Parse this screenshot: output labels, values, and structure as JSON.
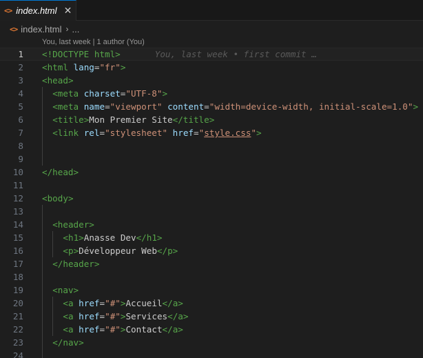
{
  "tab": {
    "icon": "html-file-icon",
    "label": "index.html",
    "close_glyph": "✕"
  },
  "breadcrumb": {
    "file": "index.html",
    "separator": "›",
    "ellipsis": "..."
  },
  "codelens": "You, last week | 1 author (You)",
  "blame": "You, last week • first commit …",
  "colors": {
    "tag": "#57a64a",
    "attribute": "#9cdcfe",
    "string": "#ce9178",
    "text": "#cccccc",
    "line_number": "#6e7681"
  },
  "lines": [
    {
      "n": "1",
      "indent": 0,
      "tokens": [
        [
          "doctype",
          "<!DOCTYPE html>"
        ]
      ],
      "blame": true,
      "current": true
    },
    {
      "n": "2",
      "indent": 0,
      "tokens": [
        [
          "bracket",
          "<"
        ],
        [
          "tag",
          "html"
        ],
        [
          "text",
          " "
        ],
        [
          "attr",
          "lang"
        ],
        [
          "text",
          "="
        ],
        [
          "str",
          "\"fr\""
        ],
        [
          "bracket",
          ">"
        ]
      ]
    },
    {
      "n": "3",
      "indent": 0,
      "tokens": [
        [
          "bracket",
          "<"
        ],
        [
          "tag",
          "head"
        ],
        [
          "bracket",
          ">"
        ]
      ]
    },
    {
      "n": "4",
      "indent": 1,
      "tokens": [
        [
          "bracket",
          "<"
        ],
        [
          "tag",
          "meta"
        ],
        [
          "text",
          " "
        ],
        [
          "attr",
          "charset"
        ],
        [
          "text",
          "="
        ],
        [
          "str",
          "\"UTF-8\""
        ],
        [
          "bracket",
          ">"
        ]
      ]
    },
    {
      "n": "5",
      "indent": 1,
      "tokens": [
        [
          "bracket",
          "<"
        ],
        [
          "tag",
          "meta"
        ],
        [
          "text",
          " "
        ],
        [
          "attr",
          "name"
        ],
        [
          "text",
          "="
        ],
        [
          "str",
          "\"viewport\""
        ],
        [
          "text",
          " "
        ],
        [
          "attr",
          "content"
        ],
        [
          "text",
          "="
        ],
        [
          "str",
          "\"width=device-width, initial-scale=1.0\""
        ],
        [
          "bracket",
          ">"
        ]
      ]
    },
    {
      "n": "6",
      "indent": 1,
      "tokens": [
        [
          "bracket",
          "<"
        ],
        [
          "tag",
          "title"
        ],
        [
          "bracket",
          ">"
        ],
        [
          "text",
          "Mon Premier Site"
        ],
        [
          "bracket",
          "</"
        ],
        [
          "tag",
          "title"
        ],
        [
          "bracket",
          ">"
        ]
      ]
    },
    {
      "n": "7",
      "indent": 1,
      "tokens": [
        [
          "bracket",
          "<"
        ],
        [
          "tag",
          "link"
        ],
        [
          "text",
          " "
        ],
        [
          "attr",
          "rel"
        ],
        [
          "text",
          "="
        ],
        [
          "str",
          "\"stylesheet\""
        ],
        [
          "text",
          " "
        ],
        [
          "attr",
          "href"
        ],
        [
          "text",
          "="
        ],
        [
          "str",
          "\""
        ],
        [
          "strlink",
          "style.css"
        ],
        [
          "str",
          "\""
        ],
        [
          "bracket",
          ">"
        ]
      ]
    },
    {
      "n": "8",
      "indent": 1,
      "tokens": []
    },
    {
      "n": "9",
      "indent": 1,
      "tokens": []
    },
    {
      "n": "10",
      "indent": 0,
      "tokens": [
        [
          "bracket",
          "</"
        ],
        [
          "tag",
          "head"
        ],
        [
          "bracket",
          ">"
        ]
      ]
    },
    {
      "n": "11",
      "indent": 0,
      "tokens": []
    },
    {
      "n": "12",
      "indent": 0,
      "tokens": [
        [
          "bracket",
          "<"
        ],
        [
          "tag",
          "body"
        ],
        [
          "bracket",
          ">"
        ]
      ]
    },
    {
      "n": "13",
      "indent": 1,
      "tokens": []
    },
    {
      "n": "14",
      "indent": 1,
      "tokens": [
        [
          "bracket",
          "<"
        ],
        [
          "tag",
          "header"
        ],
        [
          "bracket",
          ">"
        ]
      ]
    },
    {
      "n": "15",
      "indent": 2,
      "tokens": [
        [
          "bracket",
          "<"
        ],
        [
          "tag",
          "h1"
        ],
        [
          "bracket",
          ">"
        ],
        [
          "text",
          "Anasse Dev"
        ],
        [
          "bracket",
          "</"
        ],
        [
          "tag",
          "h1"
        ],
        [
          "bracket",
          ">"
        ]
      ]
    },
    {
      "n": "16",
      "indent": 2,
      "tokens": [
        [
          "bracket",
          "<"
        ],
        [
          "tag",
          "p"
        ],
        [
          "bracket",
          ">"
        ],
        [
          "text",
          "Développeur Web"
        ],
        [
          "bracket",
          "</"
        ],
        [
          "tag",
          "p"
        ],
        [
          "bracket",
          ">"
        ]
      ]
    },
    {
      "n": "17",
      "indent": 1,
      "tokens": [
        [
          "bracket",
          "</"
        ],
        [
          "tag",
          "header"
        ],
        [
          "bracket",
          ">"
        ]
      ]
    },
    {
      "n": "18",
      "indent": 1,
      "tokens": []
    },
    {
      "n": "19",
      "indent": 1,
      "tokens": [
        [
          "bracket",
          "<"
        ],
        [
          "tag",
          "nav"
        ],
        [
          "bracket",
          ">"
        ]
      ]
    },
    {
      "n": "20",
      "indent": 2,
      "tokens": [
        [
          "bracket",
          "<"
        ],
        [
          "tag",
          "a"
        ],
        [
          "text",
          " "
        ],
        [
          "attr",
          "href"
        ],
        [
          "text",
          "="
        ],
        [
          "str",
          "\"#\""
        ],
        [
          "bracket",
          ">"
        ],
        [
          "text",
          "Accueil"
        ],
        [
          "bracket",
          "</"
        ],
        [
          "tag",
          "a"
        ],
        [
          "bracket",
          ">"
        ]
      ]
    },
    {
      "n": "21",
      "indent": 2,
      "tokens": [
        [
          "bracket",
          "<"
        ],
        [
          "tag",
          "a"
        ],
        [
          "text",
          " "
        ],
        [
          "attr",
          "href"
        ],
        [
          "text",
          "="
        ],
        [
          "str",
          "\"#\""
        ],
        [
          "bracket",
          ">"
        ],
        [
          "text",
          "Services"
        ],
        [
          "bracket",
          "</"
        ],
        [
          "tag",
          "a"
        ],
        [
          "bracket",
          ">"
        ]
      ]
    },
    {
      "n": "22",
      "indent": 2,
      "tokens": [
        [
          "bracket",
          "<"
        ],
        [
          "tag",
          "a"
        ],
        [
          "text",
          " "
        ],
        [
          "attr",
          "href"
        ],
        [
          "text",
          "="
        ],
        [
          "str",
          "\"#\""
        ],
        [
          "bracket",
          ">"
        ],
        [
          "text",
          "Contact"
        ],
        [
          "bracket",
          "</"
        ],
        [
          "tag",
          "a"
        ],
        [
          "bracket",
          ">"
        ]
      ]
    },
    {
      "n": "23",
      "indent": 1,
      "tokens": [
        [
          "bracket",
          "</"
        ],
        [
          "tag",
          "nav"
        ],
        [
          "bracket",
          ">"
        ]
      ]
    },
    {
      "n": "24",
      "indent": 1,
      "tokens": []
    }
  ]
}
